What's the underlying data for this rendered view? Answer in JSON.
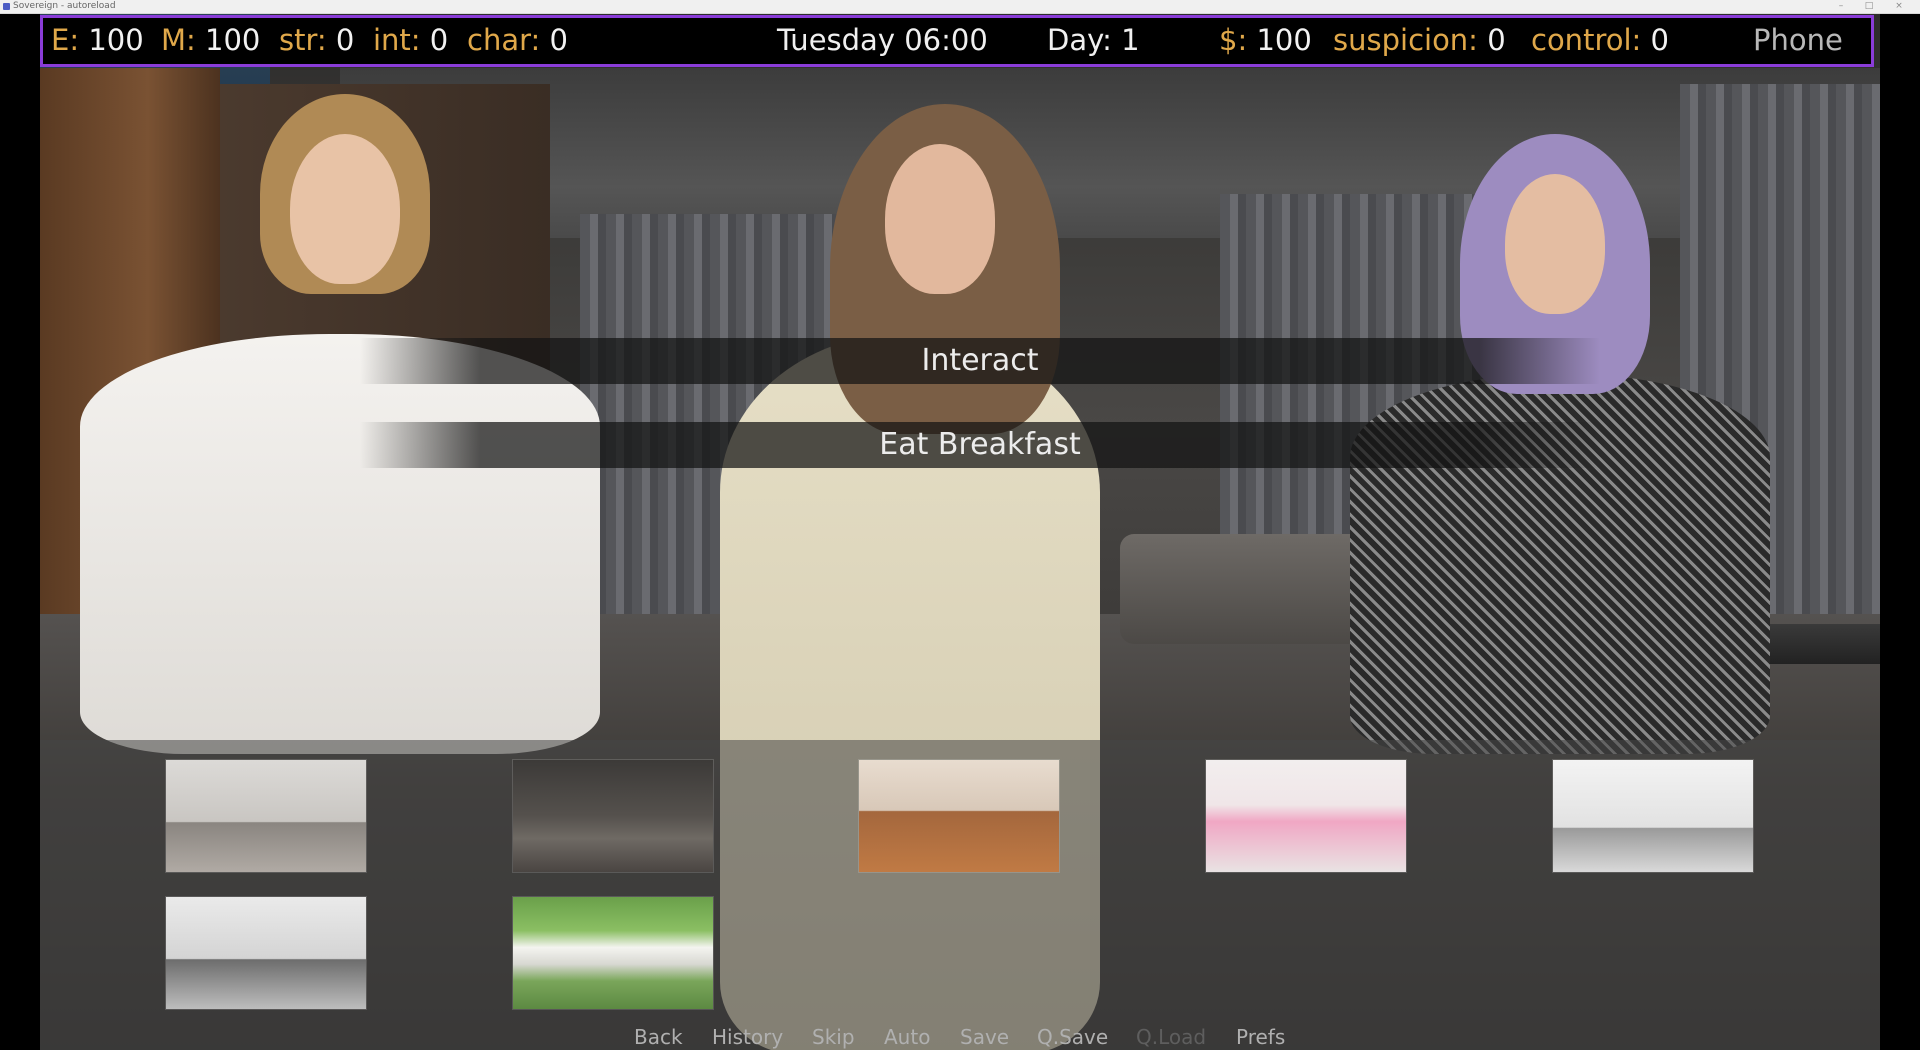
{
  "window": {
    "title": "Sovereign - autoreload"
  },
  "stats": {
    "energy": {
      "label": "E:",
      "value": "100"
    },
    "mood": {
      "label": "M:",
      "value": "100"
    },
    "str": {
      "label": "str:",
      "value": "0"
    },
    "int": {
      "label": "int:",
      "value": "0"
    },
    "char": {
      "label": "char:",
      "value": "0"
    },
    "datetime": "Tuesday 06:00",
    "day": "Day: 1",
    "money": {
      "label": "$:",
      "value": "100"
    },
    "suspicion": {
      "label": "suspicion:",
      "value": "0"
    },
    "control": {
      "label": "control:",
      "value": "0"
    },
    "phone": "Phone"
  },
  "choices": [
    {
      "label": "Interact"
    },
    {
      "label": "Eat Breakfast"
    }
  ],
  "locations": [
    {
      "name": "bedroom-1"
    },
    {
      "name": "bedroom-2"
    },
    {
      "name": "bedroom-3"
    },
    {
      "name": "pink-room"
    },
    {
      "name": "bathroom-1"
    },
    {
      "name": "bathroom-2"
    },
    {
      "name": "neighborhood"
    }
  ],
  "quick_menu": {
    "back": "Back",
    "history": "History",
    "skip": "Skip",
    "auto": "Auto",
    "save": "Save",
    "qsave": "Q.Save",
    "qload": "Q.Load",
    "prefs": "Prefs"
  },
  "colors": {
    "stat_label": "#e0a84a",
    "border_accent": "#8a3cd8",
    "disabled": "#5e5e5e"
  }
}
